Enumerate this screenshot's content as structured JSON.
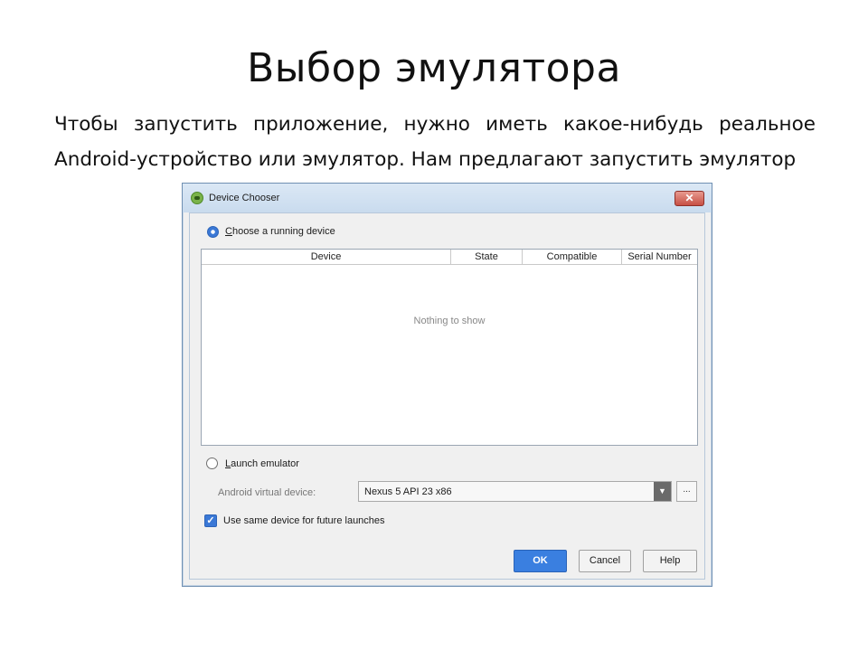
{
  "slide": {
    "title": "Выбор эмулятора",
    "body_text": "Чтобы запустить приложение, нужно иметь какое-нибудь реальное Android-устройство или эмулятор. Нам предлагают запустить эмулятор"
  },
  "dialog": {
    "title": "Device Chooser",
    "close_label": "✕",
    "running": {
      "label_mnemonic": "C",
      "label_rest": "hoose a running device",
      "selected": true
    },
    "table": {
      "columns": [
        "Device",
        "State",
        "Compatible",
        "Serial Number"
      ],
      "rows": [],
      "empty_text": "Nothing to show"
    },
    "emulator": {
      "label_mnemonic": "L",
      "label_rest": "aunch emulator",
      "selected": false,
      "avd_label": "Android virtual device:",
      "avd_value": "Nexus 5 API 23 x86",
      "browse_label": "..."
    },
    "same_device": {
      "label": "Use same device for future launches",
      "checked": true
    },
    "buttons": {
      "ok": "OK",
      "cancel": "Cancel",
      "help": "Help"
    }
  }
}
